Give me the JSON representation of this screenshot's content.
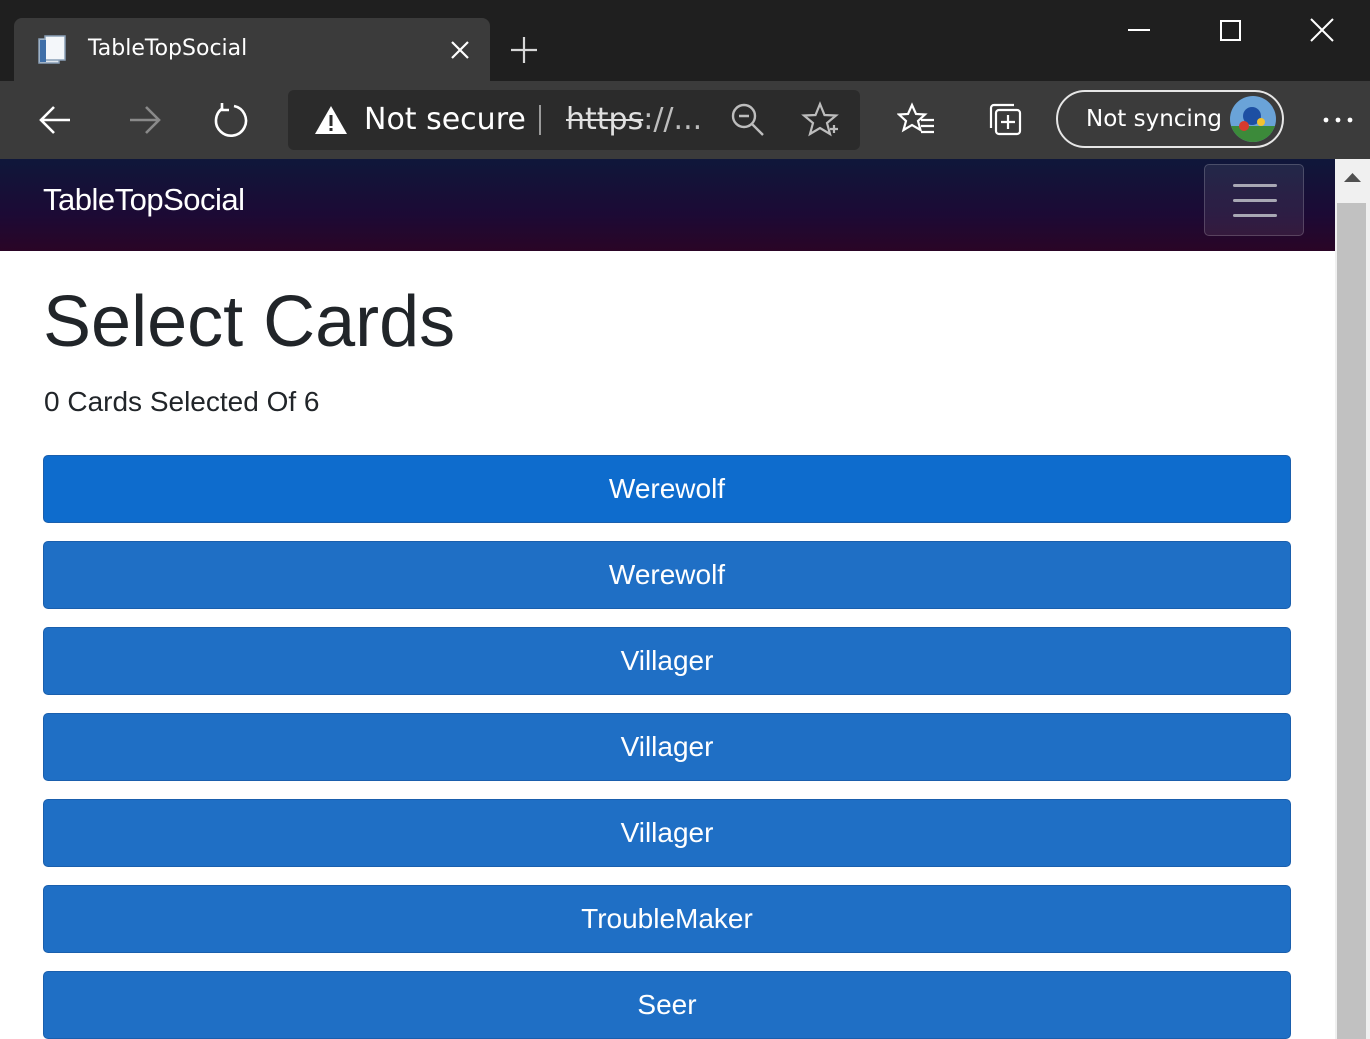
{
  "browser": {
    "tab_title": "TableTopSocial",
    "security_label": "Not secure",
    "url_scheme": "https",
    "url_rest": "://...",
    "sync_label": "Not syncing"
  },
  "page": {
    "brand": "TableTopSocial",
    "title": "Select Cards",
    "selection_count": "0 Cards Selected Of 6",
    "cards": [
      "Werewolf",
      "Werewolf",
      "Villager",
      "Villager",
      "Villager",
      "TroubleMaker",
      "Seer"
    ]
  },
  "colors": {
    "card_button": "#1f6fc5",
    "card_button_active": "#0e6ccd",
    "navbar_top": "#0f173a",
    "navbar_bottom": "#2a0526"
  }
}
